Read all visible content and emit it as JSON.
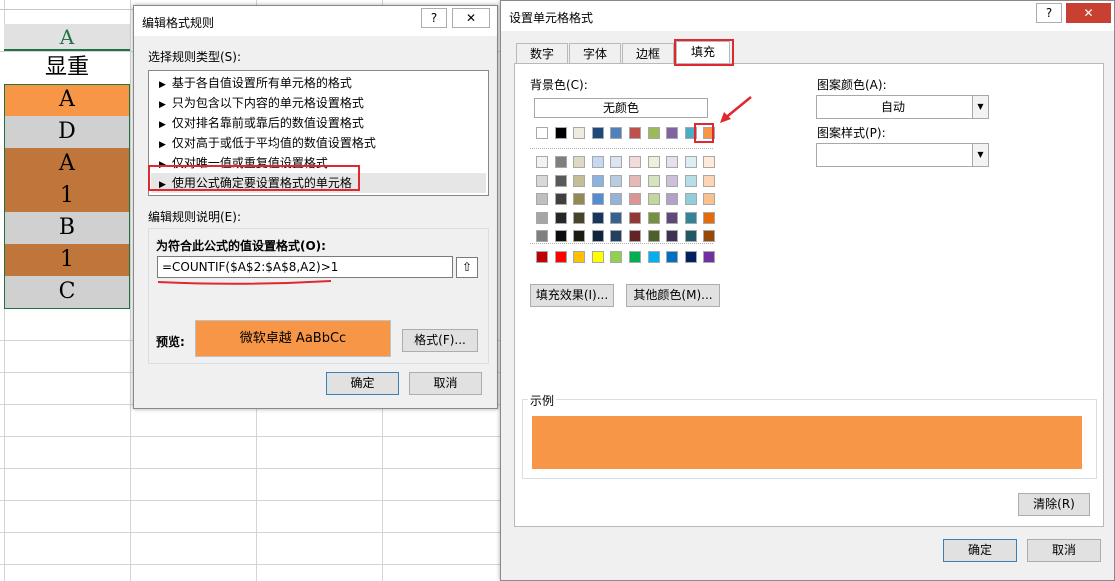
{
  "sheet": {
    "column_header": "A",
    "cells": [
      {
        "text": "显重",
        "bg": "#ffffff"
      },
      {
        "text": "A",
        "bg": "#f79646"
      },
      {
        "text": "D",
        "bg": "#d0d0d0"
      },
      {
        "text": "A",
        "bg": "#c0763a"
      },
      {
        "text": "1",
        "bg": "#c0763a"
      },
      {
        "text": "B",
        "bg": "#d0d0d0"
      },
      {
        "text": "1",
        "bg": "#c0763a"
      },
      {
        "text": "C",
        "bg": "#d0d0d0"
      }
    ]
  },
  "edit_rule_dialog": {
    "title": "编辑格式规则",
    "help": "?",
    "close": "✕",
    "select_type_label": "选择规则类型(S):",
    "rule_types": [
      "基于各自值设置所有单元格的格式",
      "只为包含以下内容的单元格设置格式",
      "仅对排名靠前或靠后的数值设置格式",
      "仅对高于或低于平均值的数值设置格式",
      "仅对唯一值或重复值设置格式",
      "使用公式确定要设置格式的单元格"
    ],
    "selected_index": 5,
    "edit_desc_label": "编辑规则说明(E):",
    "formula_label": "为符合此公式的值设置格式(O):",
    "formula": "=COUNTIF($A$2:$A$8,A2)>1",
    "preview_label": "预览:",
    "preview_text": "微软卓越  AaBbCc",
    "format_button": "格式(F)...",
    "ok": "确定",
    "cancel": "取消"
  },
  "format_cells_dialog": {
    "title": "设置单元格格式",
    "help": "?",
    "close": "✕",
    "tabs": [
      "数字",
      "字体",
      "边框",
      "填充"
    ],
    "active_tab": "填充",
    "bg_color_label": "背景色(C):",
    "no_color": "无颜色",
    "pattern_color_label": "图案颜色(A):",
    "pattern_color_value": "自动",
    "pattern_style_label": "图案样式(P):",
    "pattern_style_value": "",
    "fill_effects": "填充效果(I)...",
    "more_colors": "其他颜色(M)...",
    "sample_label": "示例",
    "clear": "清除(R)",
    "ok": "确定",
    "cancel": "取消",
    "selected_color": "#f79646",
    "theme_colors": [
      "#ffffff",
      "#000000",
      "#eeece1",
      "#1f497d",
      "#4f81bd",
      "#c0504d",
      "#9bbb59",
      "#8064a2",
      "#4bacc6",
      "#f79646"
    ],
    "shade_rows": [
      [
        "#f2f2f2",
        "#7f7f7f",
        "#ddd9c3",
        "#c6d9f0",
        "#dbe5f1",
        "#f2dcdb",
        "#ebf1dd",
        "#e5e0ec",
        "#dbeef3",
        "#fdeada"
      ],
      [
        "#d8d8d8",
        "#595959",
        "#c4bd97",
        "#8db3e2",
        "#b8cce4",
        "#e5b9b7",
        "#d7e3bc",
        "#ccc1d9",
        "#b7dde8",
        "#fbd5b5"
      ],
      [
        "#bfbfbf",
        "#3f3f3f",
        "#938953",
        "#548dd4",
        "#95b3d7",
        "#d99694",
        "#c3d69b",
        "#b2a2c7",
        "#92cddc",
        "#fac08f"
      ],
      [
        "#a5a5a5",
        "#262626",
        "#494429",
        "#17365d",
        "#366092",
        "#953734",
        "#76923c",
        "#5f497a",
        "#31859b",
        "#e36c09"
      ],
      [
        "#7f7f7f",
        "#0c0c0c",
        "#1d1b10",
        "#0f243e",
        "#244061",
        "#632423",
        "#4f6128",
        "#3f3151",
        "#205867",
        "#974806"
      ]
    ],
    "standard_colors": [
      "#c00000",
      "#ff0000",
      "#ffc000",
      "#ffff00",
      "#92d050",
      "#00b050",
      "#00b0f0",
      "#0070c0",
      "#002060",
      "#7030a0"
    ]
  }
}
